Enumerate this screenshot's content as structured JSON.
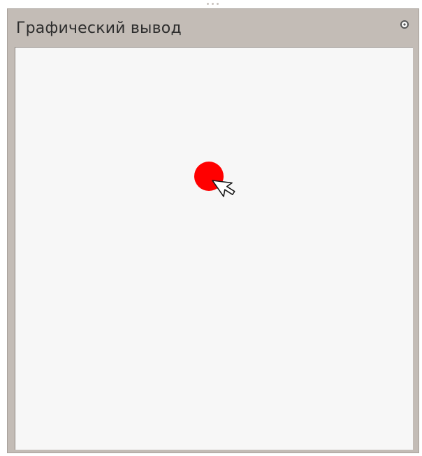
{
  "panel": {
    "title": "Графический вывод",
    "pin_icon": "pin-icon"
  },
  "canvas": {
    "background": "#f7f7f7",
    "shapes": [
      {
        "type": "circle",
        "fill": "#ff0000"
      }
    ],
    "cursor_icon": "mouse-pointer-icon"
  }
}
